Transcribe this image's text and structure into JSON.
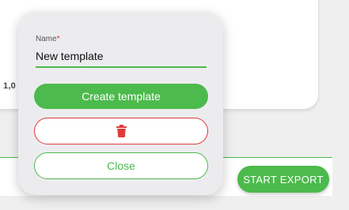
{
  "background": {
    "partial_value": "1,0"
  },
  "popup": {
    "name_label": "Name",
    "required_mark": "*",
    "name_value": "New template",
    "create_label": "Create template",
    "close_label": "Close"
  },
  "footer": {
    "export_label": "START EXPORT"
  },
  "colors": {
    "accent": "#4cba4c",
    "danger": "#e03b3b"
  },
  "icons": {
    "delete": "trash-icon"
  }
}
